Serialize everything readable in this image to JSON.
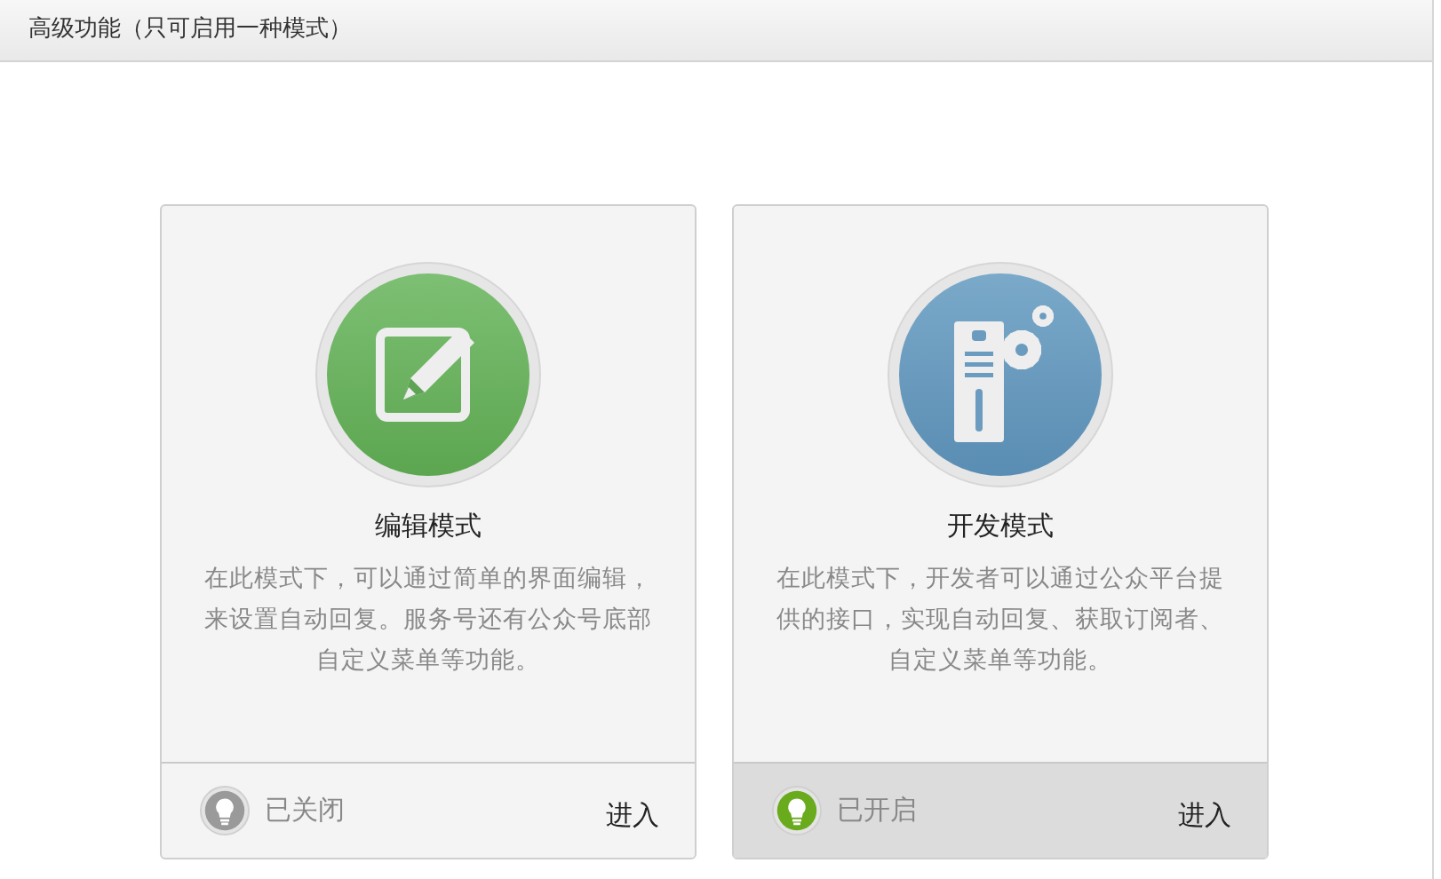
{
  "header": {
    "title": "高级功能（只可启用一种模式）"
  },
  "modes": [
    {
      "kind": "edit",
      "title": "编辑模式",
      "description": "在此模式下，可以通过简单的界面编辑，来设置自动回复。服务号还有公众号底部自定义菜单等功能。",
      "on": false,
      "status": "已关闭",
      "action": "进入"
    },
    {
      "kind": "dev",
      "title": "开发模式",
      "description": "在此模式下，开发者可以通过公众平台提供的接口，实现自动回复、获取订阅者、自定义菜单等功能。",
      "on": true,
      "status": "已开启",
      "action": "进入"
    }
  ]
}
